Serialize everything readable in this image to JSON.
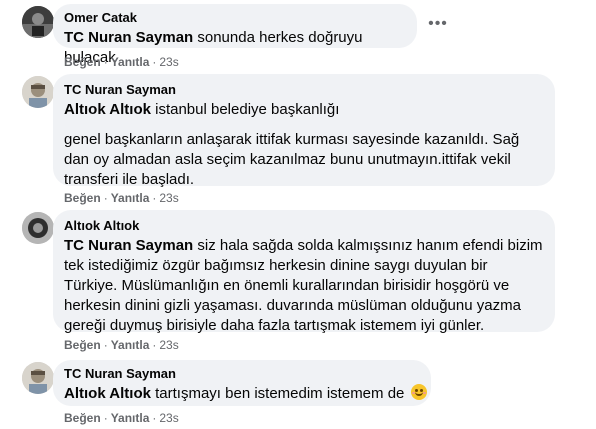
{
  "comments": [
    {
      "author": "Omer Catak",
      "mention": "TC Nuran Sayman",
      "text": "sonunda herkes doğruyu bulacak",
      "like_label": "Beğen",
      "reply_label": "Yanıtla",
      "time": "23s",
      "more_icon": "more-horizontal-icon"
    },
    {
      "author": "TC Nuran Sayman",
      "mention": "Altıok Altıok",
      "text": "istanbul belediye başkanlığı",
      "paragraph2": "genel başkanların anlaşarak ittifak kurması sayesinde kazanıldı. Sağ dan oy almadan asla seçim kazanılmaz bunu unutmayın.ittifak vekil transferi ile başladı.",
      "like_label": "Beğen",
      "reply_label": "Yanıtla",
      "time": "23s"
    },
    {
      "author": "Altıok Altıok",
      "mention": "TC Nuran Sayman",
      "text": "siz hala sağda solda kalmışsınız hanım efendi bizim tek istediğimiz özgür bağımsız herkesin dinine saygı duyulan bir Türkiye. Müslümanlığın en önemli kurallarından birisidir hoşgörü ve herkesin dinini gizli yaşaması. duvarında müslüman olduğunu yazma gereği duymuş birisiyle daha fazla tartışmak istemem iyi günler.",
      "like_label": "Beğen",
      "reply_label": "Yanıtla",
      "time": "23s"
    },
    {
      "author": "TC Nuran Sayman",
      "mention": "Altıok Altıok",
      "text": "tartışmayı ben istemedim istemem de",
      "emoji": "smiling-face-emoji",
      "like_label": "Beğen",
      "reply_label": "Yanıtla",
      "time": "23s"
    }
  ]
}
